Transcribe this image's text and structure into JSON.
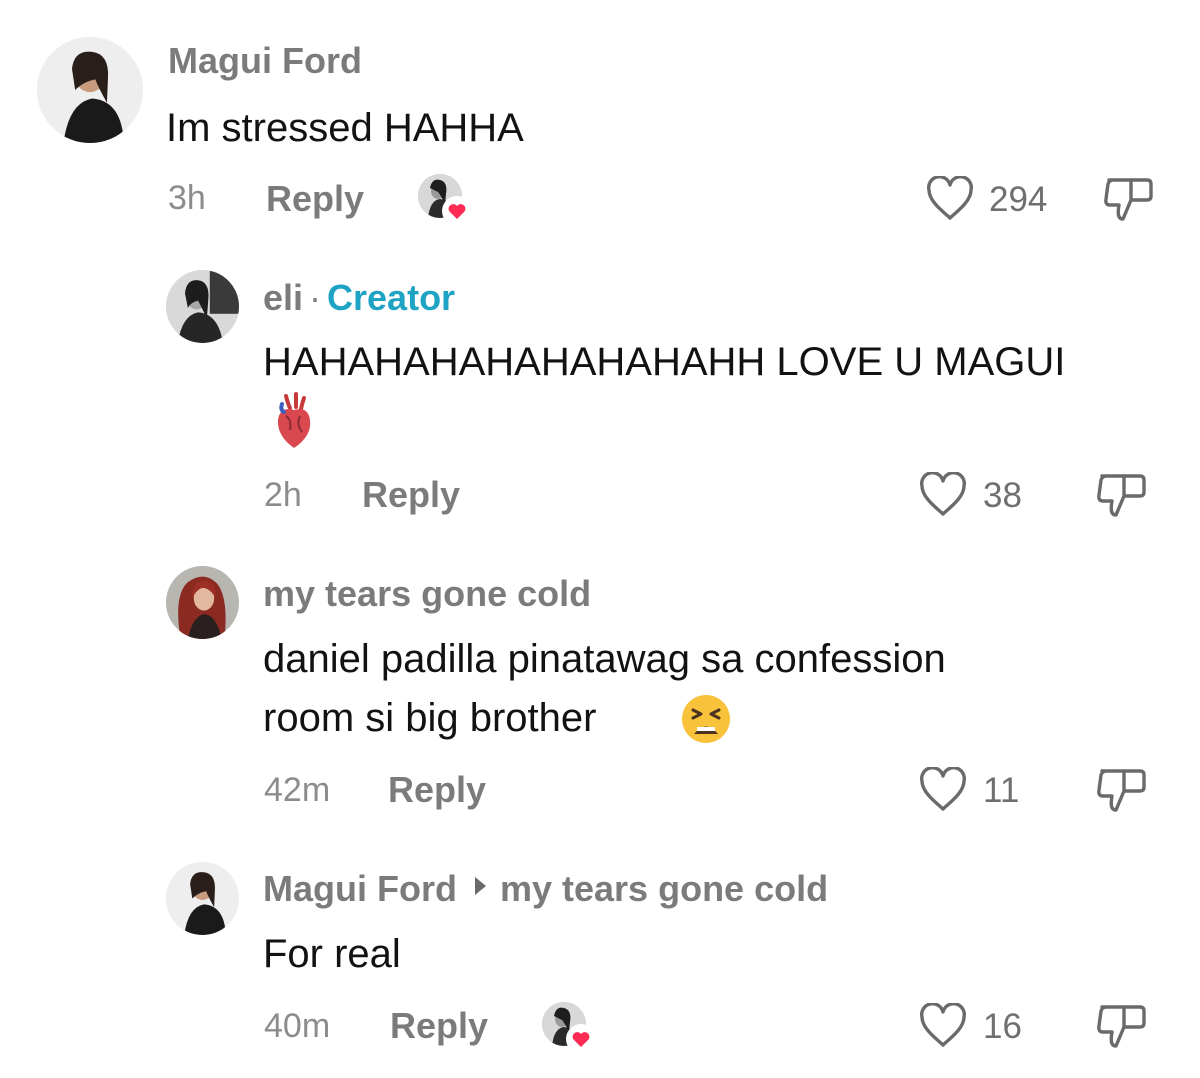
{
  "colors": {
    "name": "#7b7b7b",
    "creator": "#1fa3c4",
    "text": "#121212",
    "meta": "#8c8c8c",
    "heart_badge": "#fe2c55"
  },
  "comments": [
    {
      "author": "Magui Ford",
      "text": "Im stressed HAHHA",
      "time": "3h",
      "reply_label": "Reply",
      "likes": "294",
      "creator_liked": true,
      "icons": [
        "avatar",
        "creator-like-badge-icon",
        "heart-outline-icon",
        "dislike-icon"
      ]
    },
    {
      "author": "eli",
      "separator": "·",
      "badge": "Creator",
      "text": "HAHAHAHAHAHAHAHAHH LOVE U MAGUI",
      "emoji": "anatomical-heart-emoji",
      "time": "2h",
      "reply_label": "Reply",
      "likes": "38",
      "is_reply": true
    },
    {
      "author": "my tears gone cold",
      "text_line1": "daniel padilla pinatawag sa confession",
      "text_line2": "room si big brother",
      "emoji": "tired-face-emoji",
      "time": "42m",
      "reply_label": "Reply",
      "likes": "11",
      "is_reply": true
    },
    {
      "author": "Magui Ford",
      "reply_to": "my tears gone cold",
      "text": "For real",
      "time": "40m",
      "reply_label": "Reply",
      "likes": "16",
      "creator_liked": true,
      "is_reply": true
    }
  ]
}
